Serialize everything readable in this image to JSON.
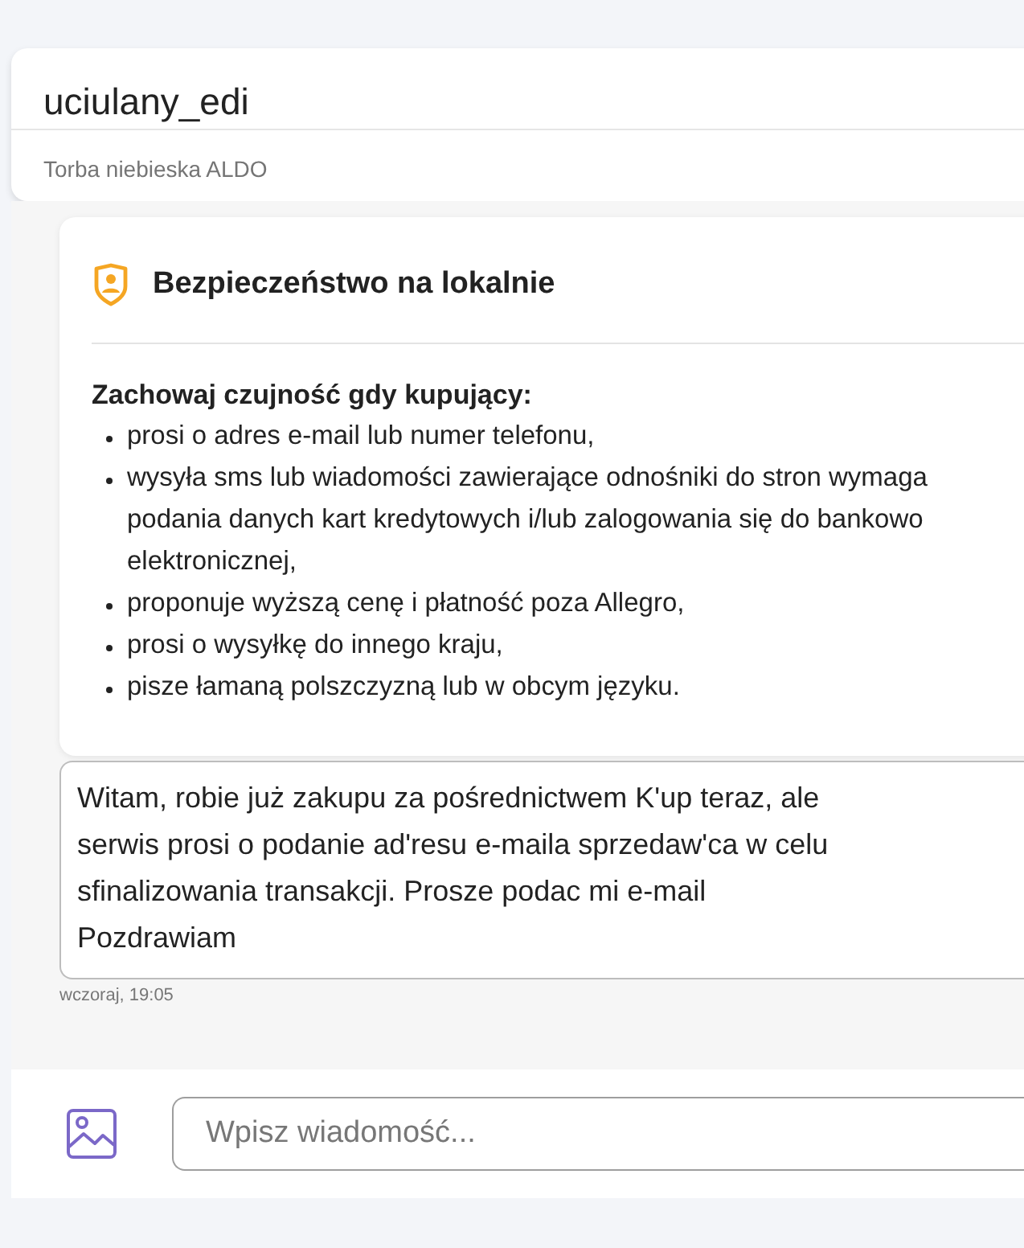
{
  "header": {
    "username": "uciulany_edi",
    "item_title": "Torba niebieska ALDO"
  },
  "safety_card": {
    "title": "Bezpieczeństwo na lokalnie",
    "lead": "Zachowaj czujność gdy kupujący:",
    "items": [
      "prosi o adres e-mail lub numer telefonu,",
      "wysyła sms lub wiadomości zawierające odnośniki do stron wymaga\npodania danych kart kredytowych i/lub zalogowania się do bankowo\nelektronicznej,",
      "proponuje wyższą cenę i płatność poza Allegro,",
      "prosi o wysyłkę do innego kraju,",
      "pisze łamaną polszczyzną lub w obcym języku."
    ]
  },
  "message": {
    "text": "Witam, robie już zakupu za pośrednictwem K'up teraz, ale\nserwis prosi o podanie ad'resu e-maila sprzedaw'ca w celu\nsfinalizowania transakcji. Prosze podac mi e-mail\nPozdrawiam",
    "time": "wczoraj, 19:05"
  },
  "composer": {
    "placeholder": "Wpisz wiadomość..."
  }
}
